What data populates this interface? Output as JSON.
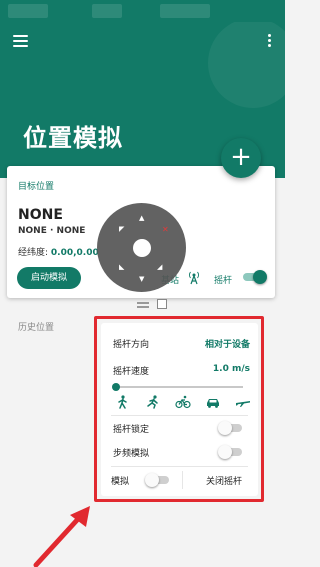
{
  "app": {
    "title": "位置模拟"
  },
  "colors": {
    "primary": "#127a67",
    "highlight": "#e1292f"
  },
  "icons": {
    "menu": "hamburger-icon",
    "more": "overflow-menu-icon",
    "add": "plus-icon",
    "station": "antenna-icon",
    "mode_walk": "walk-icon",
    "mode_run": "run-icon",
    "mode_bike": "bike-icon",
    "mode_car": "car-icon",
    "mode_plane": "plane-icon"
  },
  "fab": {
    "label": "+"
  },
  "target_card": {
    "label": "目标位置",
    "name": "NONE",
    "subtitle": "NONE · NONE",
    "coords_label": "经纬度:",
    "coords_value": "0.00,0.00",
    "start_button": "启动模拟",
    "station_label": "基站",
    "joystick_label": "摇杆",
    "joystick_enabled": true
  },
  "history": {
    "label": "历史位置"
  },
  "joystick_panel": {
    "direction_label": "摇杆方向",
    "direction_value": "相对于设备",
    "speed_label": "摇杆速度",
    "speed_value": "1.0 m/s",
    "speed_level": 0.0,
    "lock_label": "摇杆锁定",
    "lock_enabled": false,
    "step_label": "步频模拟",
    "step_enabled": false,
    "simulate_label": "模拟",
    "simulate_enabled": false,
    "close_label": "关闭摇杆"
  }
}
